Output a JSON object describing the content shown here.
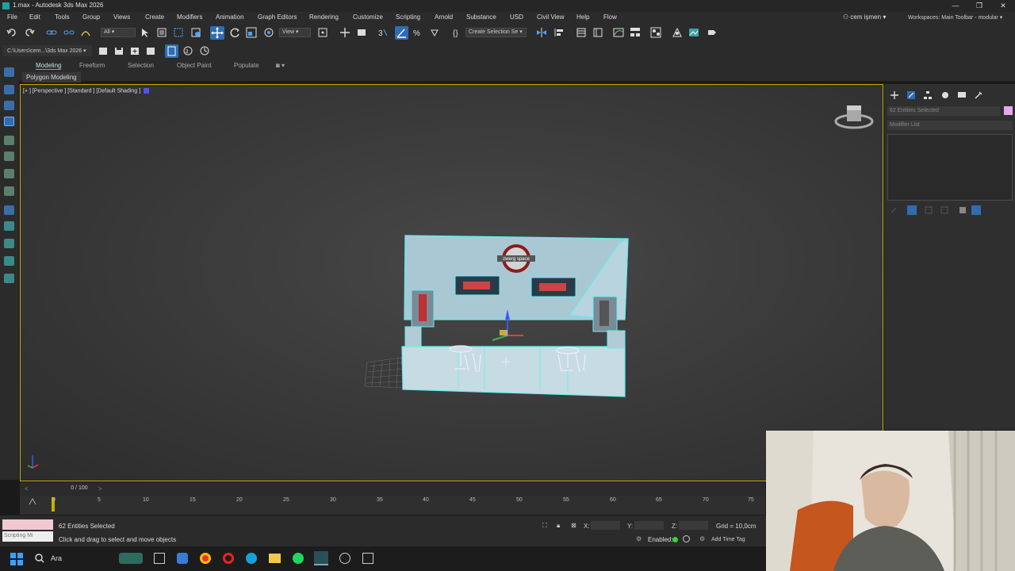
{
  "window": {
    "title": "1.max - Autodesk 3ds Max 2026",
    "buttons": [
      "—",
      "❐",
      "✕"
    ]
  },
  "menu": {
    "items": [
      "File",
      "Edit",
      "Tools",
      "Group",
      "Views",
      "Create",
      "Modifiers",
      "Animation",
      "Graph Editors",
      "Rendering",
      "Customize",
      "Scripting",
      "Arnold",
      "Substance",
      "USD",
      "Civil View",
      "Help",
      "Flow"
    ],
    "user": "cem işmen",
    "workspace_label": "Workspaces:",
    "workspace_value": "Main Toolbar - modular"
  },
  "toolbar": {
    "selection_filter": "All",
    "ref_coord": "View",
    "selection_set": "Create Selection Se"
  },
  "project_path": "C:\\Users\\cem...\\3ds Max 2026",
  "ribbon": {
    "tabs": [
      "Modeling",
      "Freeform",
      "Selection",
      "Object Paint",
      "Populate"
    ],
    "panel": "Polygon Modeling"
  },
  "viewport": {
    "label": "[+ ] [Perspective ] [Standard ] [Default Shading ]",
    "logo_text": "zwerg space",
    "wire_color": "#5ff2f2"
  },
  "command_panel": {
    "name_field": "62 Entities Selected",
    "modifier_list": "Modifier List"
  },
  "timeline": {
    "frame_display": "0 / 100",
    "ticks": [
      "0",
      "5",
      "10",
      "15",
      "20",
      "25",
      "30",
      "35",
      "40",
      "45",
      "50",
      "55",
      "60",
      "65",
      "70",
      "75"
    ]
  },
  "status": {
    "maxscript_placeholder": "Scripting Mi",
    "selection": "62 Entities Selected",
    "prompt": "Click and drag to select and move objects",
    "x_label": "X:",
    "y_label": "Y:",
    "z_label": "Z:",
    "grid": "Grid = 10,0cm",
    "enabled": "Enabled:",
    "add_time_tag": "Add Time Tag"
  },
  "taskbar": {
    "search": "Ara"
  },
  "colors": {
    "accent_blue": "#2f6cb3",
    "viewport_border": "#c6b000"
  }
}
